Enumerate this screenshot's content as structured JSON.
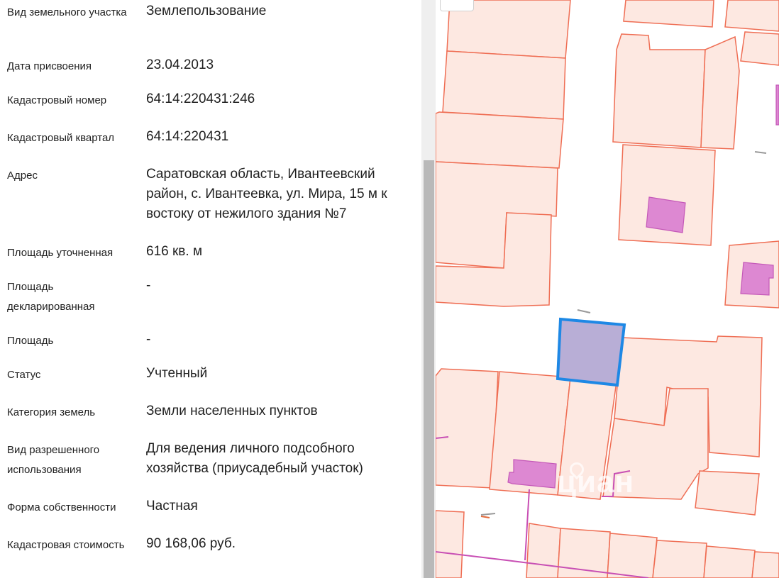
{
  "details": [
    {
      "label": "Вид земельного участка",
      "value": "Землепользование"
    },
    {
      "label": "Дата присвоения",
      "value": "23.04.2013"
    },
    {
      "label": "Кадастровый номер",
      "value": "64:14:220431:246"
    },
    {
      "label": "Кадастровый квартал",
      "value": "64:14:220431"
    },
    {
      "label": "Адрес",
      "value": "Саратовская область, Ивантеевский район, с. Ивантеевка, ул. Мира, 15 м к востоку от нежилого здания №7"
    },
    {
      "label": "Площадь уточненная",
      "value": "616 кв. м"
    },
    {
      "label": "Площадь декларированная",
      "value": "-"
    },
    {
      "label": "Площадь",
      "value": "-"
    },
    {
      "label": "Статус",
      "value": "Учтенный"
    },
    {
      "label": "Категория земель",
      "value": "Земли населенных пунктов"
    },
    {
      "label": "Вид разрешенного использования",
      "value": "Для ведения личного подсобного хозяйства (приусадебный участок)"
    },
    {
      "label": "Форма собственности",
      "value": "Частная"
    },
    {
      "label": "Кадастровая стоимость",
      "value": "90 168,06 руб."
    }
  ],
  "map": {
    "watermark": "циан",
    "colors": {
      "plot_fill": "#fde8e1",
      "plot_stroke": "#ef6e54",
      "building_fill": "#dd88d2",
      "selected_fill": "#b8aed6",
      "selected_stroke": "#1e88e5",
      "utility_line": "#c84fb4"
    }
  }
}
